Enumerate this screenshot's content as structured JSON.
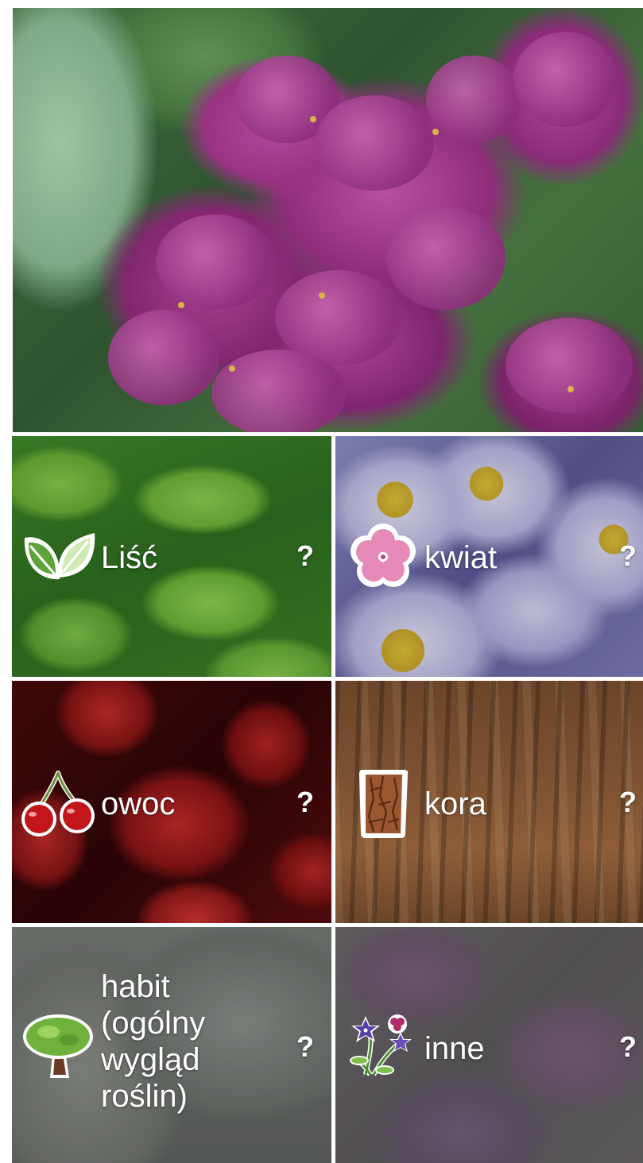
{
  "hero": {
    "image_name": "lilac-photo"
  },
  "tiles": [
    {
      "label": "Liść",
      "help": "?",
      "icon": "leaf-icon"
    },
    {
      "label": "kwiat",
      "help": "?",
      "icon": "flower-icon"
    },
    {
      "label": "owoc",
      "help": "?",
      "icon": "cherry-icon"
    },
    {
      "label": "kora",
      "help": "?",
      "icon": "bark-icon"
    },
    {
      "label": "habit\n(ogólny\nwygląd\nroślin)",
      "help": "?",
      "icon": "tree-icon"
    },
    {
      "label": "inne",
      "help": "?",
      "icon": "wildflowers-icon"
    }
  ]
}
